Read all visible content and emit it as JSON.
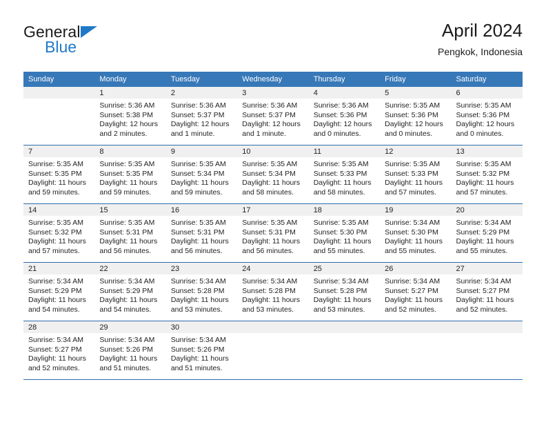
{
  "brand": {
    "name_top": "General",
    "name_bottom": "Blue",
    "accent_color": "#2079c8",
    "header_color": "#3778b8"
  },
  "header": {
    "title": "April 2024",
    "subtitle": "Pengkok, Indonesia"
  },
  "weekdays": [
    "Sunday",
    "Monday",
    "Tuesday",
    "Wednesday",
    "Thursday",
    "Friday",
    "Saturday"
  ],
  "weeks": [
    [
      {
        "day": ""
      },
      {
        "day": "1",
        "sunrise": "Sunrise: 5:36 AM",
        "sunset": "Sunset: 5:38 PM",
        "daylight1": "Daylight: 12 hours",
        "daylight2": "and 2 minutes."
      },
      {
        "day": "2",
        "sunrise": "Sunrise: 5:36 AM",
        "sunset": "Sunset: 5:37 PM",
        "daylight1": "Daylight: 12 hours",
        "daylight2": "and 1 minute."
      },
      {
        "day": "3",
        "sunrise": "Sunrise: 5:36 AM",
        "sunset": "Sunset: 5:37 PM",
        "daylight1": "Daylight: 12 hours",
        "daylight2": "and 1 minute."
      },
      {
        "day": "4",
        "sunrise": "Sunrise: 5:36 AM",
        "sunset": "Sunset: 5:36 PM",
        "daylight1": "Daylight: 12 hours",
        "daylight2": "and 0 minutes."
      },
      {
        "day": "5",
        "sunrise": "Sunrise: 5:35 AM",
        "sunset": "Sunset: 5:36 PM",
        "daylight1": "Daylight: 12 hours",
        "daylight2": "and 0 minutes."
      },
      {
        "day": "6",
        "sunrise": "Sunrise: 5:35 AM",
        "sunset": "Sunset: 5:36 PM",
        "daylight1": "Daylight: 12 hours",
        "daylight2": "and 0 minutes."
      }
    ],
    [
      {
        "day": "7",
        "sunrise": "Sunrise: 5:35 AM",
        "sunset": "Sunset: 5:35 PM",
        "daylight1": "Daylight: 11 hours",
        "daylight2": "and 59 minutes."
      },
      {
        "day": "8",
        "sunrise": "Sunrise: 5:35 AM",
        "sunset": "Sunset: 5:35 PM",
        "daylight1": "Daylight: 11 hours",
        "daylight2": "and 59 minutes."
      },
      {
        "day": "9",
        "sunrise": "Sunrise: 5:35 AM",
        "sunset": "Sunset: 5:34 PM",
        "daylight1": "Daylight: 11 hours",
        "daylight2": "and 59 minutes."
      },
      {
        "day": "10",
        "sunrise": "Sunrise: 5:35 AM",
        "sunset": "Sunset: 5:34 PM",
        "daylight1": "Daylight: 11 hours",
        "daylight2": "and 58 minutes."
      },
      {
        "day": "11",
        "sunrise": "Sunrise: 5:35 AM",
        "sunset": "Sunset: 5:33 PM",
        "daylight1": "Daylight: 11 hours",
        "daylight2": "and 58 minutes."
      },
      {
        "day": "12",
        "sunrise": "Sunrise: 5:35 AM",
        "sunset": "Sunset: 5:33 PM",
        "daylight1": "Daylight: 11 hours",
        "daylight2": "and 57 minutes."
      },
      {
        "day": "13",
        "sunrise": "Sunrise: 5:35 AM",
        "sunset": "Sunset: 5:32 PM",
        "daylight1": "Daylight: 11 hours",
        "daylight2": "and 57 minutes."
      }
    ],
    [
      {
        "day": "14",
        "sunrise": "Sunrise: 5:35 AM",
        "sunset": "Sunset: 5:32 PM",
        "daylight1": "Daylight: 11 hours",
        "daylight2": "and 57 minutes."
      },
      {
        "day": "15",
        "sunrise": "Sunrise: 5:35 AM",
        "sunset": "Sunset: 5:31 PM",
        "daylight1": "Daylight: 11 hours",
        "daylight2": "and 56 minutes."
      },
      {
        "day": "16",
        "sunrise": "Sunrise: 5:35 AM",
        "sunset": "Sunset: 5:31 PM",
        "daylight1": "Daylight: 11 hours",
        "daylight2": "and 56 minutes."
      },
      {
        "day": "17",
        "sunrise": "Sunrise: 5:35 AM",
        "sunset": "Sunset: 5:31 PM",
        "daylight1": "Daylight: 11 hours",
        "daylight2": "and 56 minutes."
      },
      {
        "day": "18",
        "sunrise": "Sunrise: 5:35 AM",
        "sunset": "Sunset: 5:30 PM",
        "daylight1": "Daylight: 11 hours",
        "daylight2": "and 55 minutes."
      },
      {
        "day": "19",
        "sunrise": "Sunrise: 5:34 AM",
        "sunset": "Sunset: 5:30 PM",
        "daylight1": "Daylight: 11 hours",
        "daylight2": "and 55 minutes."
      },
      {
        "day": "20",
        "sunrise": "Sunrise: 5:34 AM",
        "sunset": "Sunset: 5:29 PM",
        "daylight1": "Daylight: 11 hours",
        "daylight2": "and 55 minutes."
      }
    ],
    [
      {
        "day": "21",
        "sunrise": "Sunrise: 5:34 AM",
        "sunset": "Sunset: 5:29 PM",
        "daylight1": "Daylight: 11 hours",
        "daylight2": "and 54 minutes."
      },
      {
        "day": "22",
        "sunrise": "Sunrise: 5:34 AM",
        "sunset": "Sunset: 5:29 PM",
        "daylight1": "Daylight: 11 hours",
        "daylight2": "and 54 minutes."
      },
      {
        "day": "23",
        "sunrise": "Sunrise: 5:34 AM",
        "sunset": "Sunset: 5:28 PM",
        "daylight1": "Daylight: 11 hours",
        "daylight2": "and 53 minutes."
      },
      {
        "day": "24",
        "sunrise": "Sunrise: 5:34 AM",
        "sunset": "Sunset: 5:28 PM",
        "daylight1": "Daylight: 11 hours",
        "daylight2": "and 53 minutes."
      },
      {
        "day": "25",
        "sunrise": "Sunrise: 5:34 AM",
        "sunset": "Sunset: 5:28 PM",
        "daylight1": "Daylight: 11 hours",
        "daylight2": "and 53 minutes."
      },
      {
        "day": "26",
        "sunrise": "Sunrise: 5:34 AM",
        "sunset": "Sunset: 5:27 PM",
        "daylight1": "Daylight: 11 hours",
        "daylight2": "and 52 minutes."
      },
      {
        "day": "27",
        "sunrise": "Sunrise: 5:34 AM",
        "sunset": "Sunset: 5:27 PM",
        "daylight1": "Daylight: 11 hours",
        "daylight2": "and 52 minutes."
      }
    ],
    [
      {
        "day": "28",
        "sunrise": "Sunrise: 5:34 AM",
        "sunset": "Sunset: 5:27 PM",
        "daylight1": "Daylight: 11 hours",
        "daylight2": "and 52 minutes."
      },
      {
        "day": "29",
        "sunrise": "Sunrise: 5:34 AM",
        "sunset": "Sunset: 5:26 PM",
        "daylight1": "Daylight: 11 hours",
        "daylight2": "and 51 minutes."
      },
      {
        "day": "30",
        "sunrise": "Sunrise: 5:34 AM",
        "sunset": "Sunset: 5:26 PM",
        "daylight1": "Daylight: 11 hours",
        "daylight2": "and 51 minutes."
      },
      {
        "day": ""
      },
      {
        "day": ""
      },
      {
        "day": ""
      },
      {
        "day": ""
      }
    ]
  ]
}
